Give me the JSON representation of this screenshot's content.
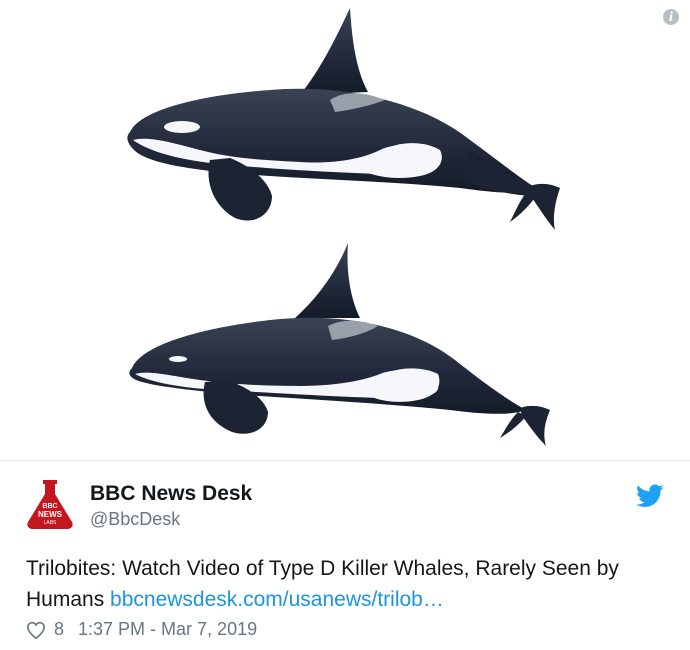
{
  "tweet": {
    "author_name": "BBC News Desk",
    "author_handle": "@BbcDesk",
    "text": "Trilobites: Watch Video of Type D Killer Whales, Rarely Seen by Humans ",
    "link_text": "bbcnewsdesk.com/usanews/trilob…",
    "like_count": "8",
    "timestamp": "1:37 PM - Mar 7, 2019"
  },
  "avatar": {
    "logo_line1": "BBC",
    "logo_line2": "NEWS",
    "logo_line3": "LABS",
    "color": "#c4161c"
  },
  "media": {
    "description_icon": "info-icon",
    "images": [
      "killer-whale-illustration-top",
      "killer-whale-illustration-bottom"
    ]
  },
  "icons": {
    "brand": "twitter-bird-icon",
    "like": "heart-icon"
  },
  "colors": {
    "link": "#1b95e0",
    "secondary_text": "#657786",
    "twitter_blue": "#1da1f2",
    "whale_body": "#242c3a"
  }
}
